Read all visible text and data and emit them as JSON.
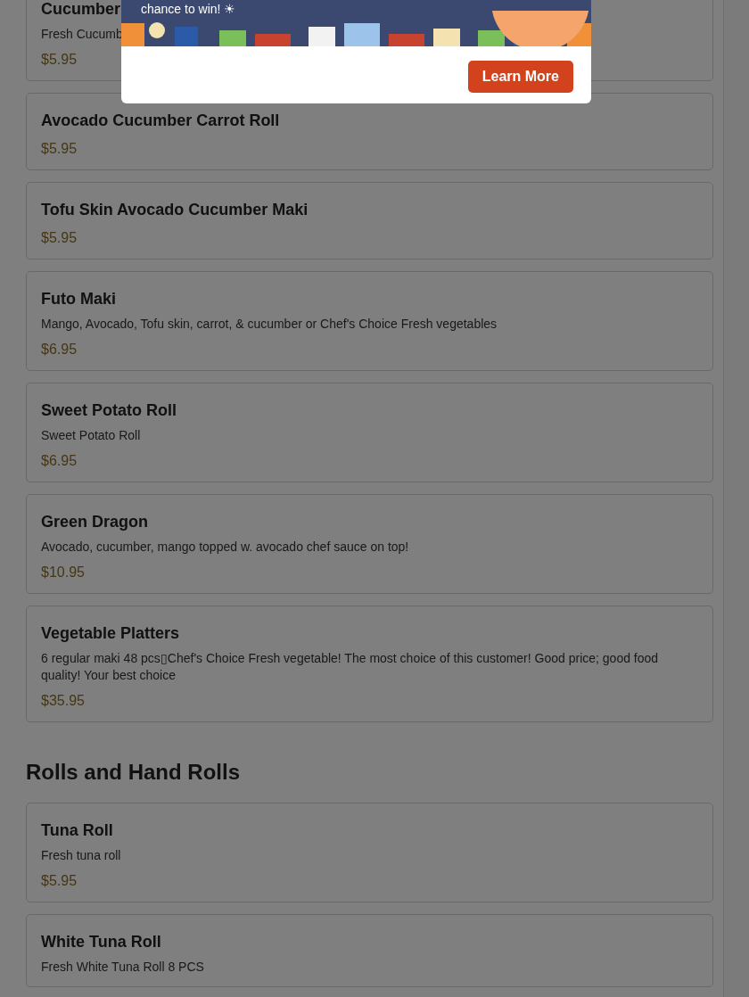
{
  "sections": [
    {
      "items": [
        {
          "name": "Cucumber",
          "description": "Fresh Cucumb",
          "price": "$5.95"
        },
        {
          "name": "Avocado Cucumber Carrot Roll",
          "price": "$5.95"
        },
        {
          "name": "Tofu Skin Avocado Cucumber Maki",
          "price": "$5.95"
        },
        {
          "name": "Futo Maki",
          "description": "Mango, Avocado, Tofu skin, carrot, & cucumber or Chef's Choice Fresh vegetables",
          "price": "$6.95"
        },
        {
          "name": "Sweet Potato Roll",
          "description": "Sweet Potato Roll",
          "price": "$6.95"
        },
        {
          "name": "Green Dragon",
          "description": "Avocado, cucumber, mango topped w. avocado chef sauce on top!",
          "price": "$10.95"
        },
        {
          "name": "Vegetable Platters",
          "description": "6 regular maki 48 pcs▯Chef's Choice Fresh vegetable! The most choice of this customer! Good price; good food quality! Your best choice",
          "price": "$35.95"
        }
      ]
    },
    {
      "heading": "Rolls and Hand Rolls",
      "items": [
        {
          "name": "Tuna Roll",
          "description": "Fresh tuna roll",
          "price": "$5.95"
        },
        {
          "name": "White Tuna Roll",
          "description": "Fresh White Tuna Roll 8 PCS"
        }
      ]
    }
  ],
  "modal": {
    "banner_text": "chance to win! ☀",
    "button": "Learn More"
  }
}
